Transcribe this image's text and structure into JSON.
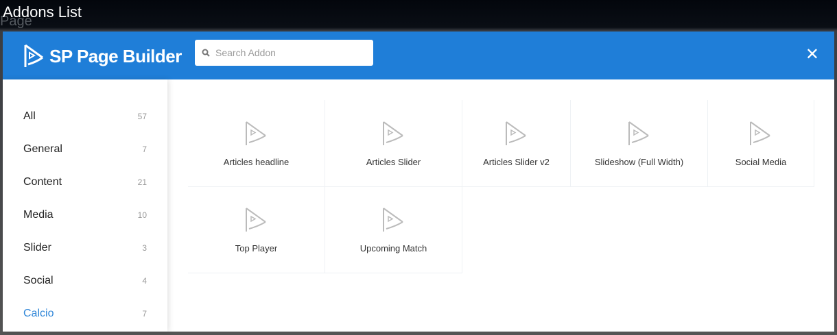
{
  "window_title": "Addons List",
  "background_text": "Page",
  "header": {
    "logo_text": "SP Page Builder",
    "search_placeholder": "Search Addon",
    "search_value": "",
    "close_icon": "close-icon"
  },
  "accent_color": "#1f7ed8",
  "categories": [
    {
      "label": "All",
      "count": "57"
    },
    {
      "label": "General",
      "count": "7"
    },
    {
      "label": "Content",
      "count": "21"
    },
    {
      "label": "Media",
      "count": "10"
    },
    {
      "label": "Slider",
      "count": "3"
    },
    {
      "label": "Social",
      "count": "4"
    },
    {
      "label": "Calcio",
      "count": "7",
      "active": true
    }
  ],
  "addons": [
    {
      "name": "Articles headline"
    },
    {
      "name": "Articles Slider"
    },
    {
      "name": "Articles Slider v2"
    },
    {
      "name": "Slideshow (Full Width)"
    },
    {
      "name": "Social Media"
    },
    {
      "name": "Top Player"
    },
    {
      "name": "Upcoming Match"
    }
  ]
}
